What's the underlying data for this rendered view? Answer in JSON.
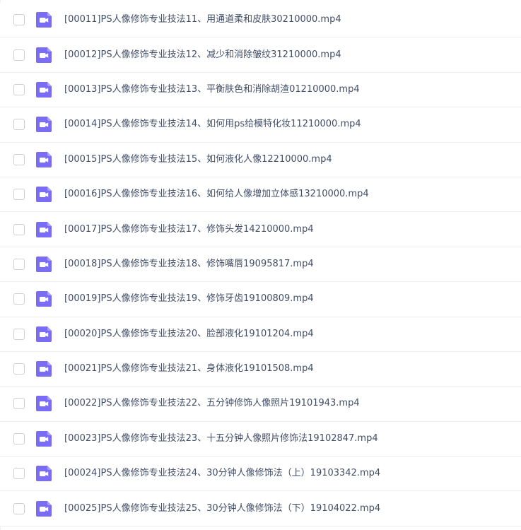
{
  "files": [
    {
      "name": "[00011]PS人像修饰专业技法11、用通道柔和皮肤30210000.mp4",
      "icon": "video-file-icon"
    },
    {
      "name": "[00012]PS人像修饰专业技法12、减少和消除皱纹31210000.mp4",
      "icon": "video-file-icon"
    },
    {
      "name": "[00013]PS人像修饰专业技法13、平衡肤色和消除胡渣01210000.mp4",
      "icon": "video-file-icon"
    },
    {
      "name": "[00014]PS人像修饰专业技法14、如何用ps给模特化妆11210000.mp4",
      "icon": "video-file-icon"
    },
    {
      "name": "[00015]PS人像修饰专业技法15、如何液化人像12210000.mp4",
      "icon": "video-file-icon"
    },
    {
      "name": "[00016]PS人像修饰专业技法16、如何给人像增加立体感13210000.mp4",
      "icon": "video-file-icon"
    },
    {
      "name": "[00017]PS人像修饰专业技法17、修饰头发14210000.mp4",
      "icon": "video-file-icon"
    },
    {
      "name": "[00018]PS人像修饰专业技法18、修饰嘴唇19095817.mp4",
      "icon": "video-file-icon"
    },
    {
      "name": "[00019]PS人像修饰专业技法19、修饰牙齿19100809.mp4",
      "icon": "video-file-icon"
    },
    {
      "name": "[00020]PS人像修饰专业技法20、脸部液化19101204.mp4",
      "icon": "video-file-icon"
    },
    {
      "name": "[00021]PS人像修饰专业技法21、身体液化19101508.mp4",
      "icon": "video-file-icon"
    },
    {
      "name": "[00022]PS人像修饰专业技法22、五分钟修饰人像照片19101943.mp4",
      "icon": "video-file-icon"
    },
    {
      "name": "[00023]PS人像修饰专业技法23、十五分钟人像照片修饰法19102847.mp4",
      "icon": "video-file-icon"
    },
    {
      "name": "[00024]PS人像修饰专业技法24、30分钟人像修饰法（上）19103342.mp4",
      "icon": "video-file-icon"
    },
    {
      "name": "[00025]PS人像修饰专业技法25、30分钟人像修饰法（下）19104022.mp4",
      "icon": "video-file-icon"
    }
  ],
  "colors": {
    "icon_bg": "#7b6cf6",
    "icon_glyph": "#ffffff",
    "text": "#424e67",
    "divider": "#eeeeee",
    "checkbox_border": "#cfcfcf"
  }
}
